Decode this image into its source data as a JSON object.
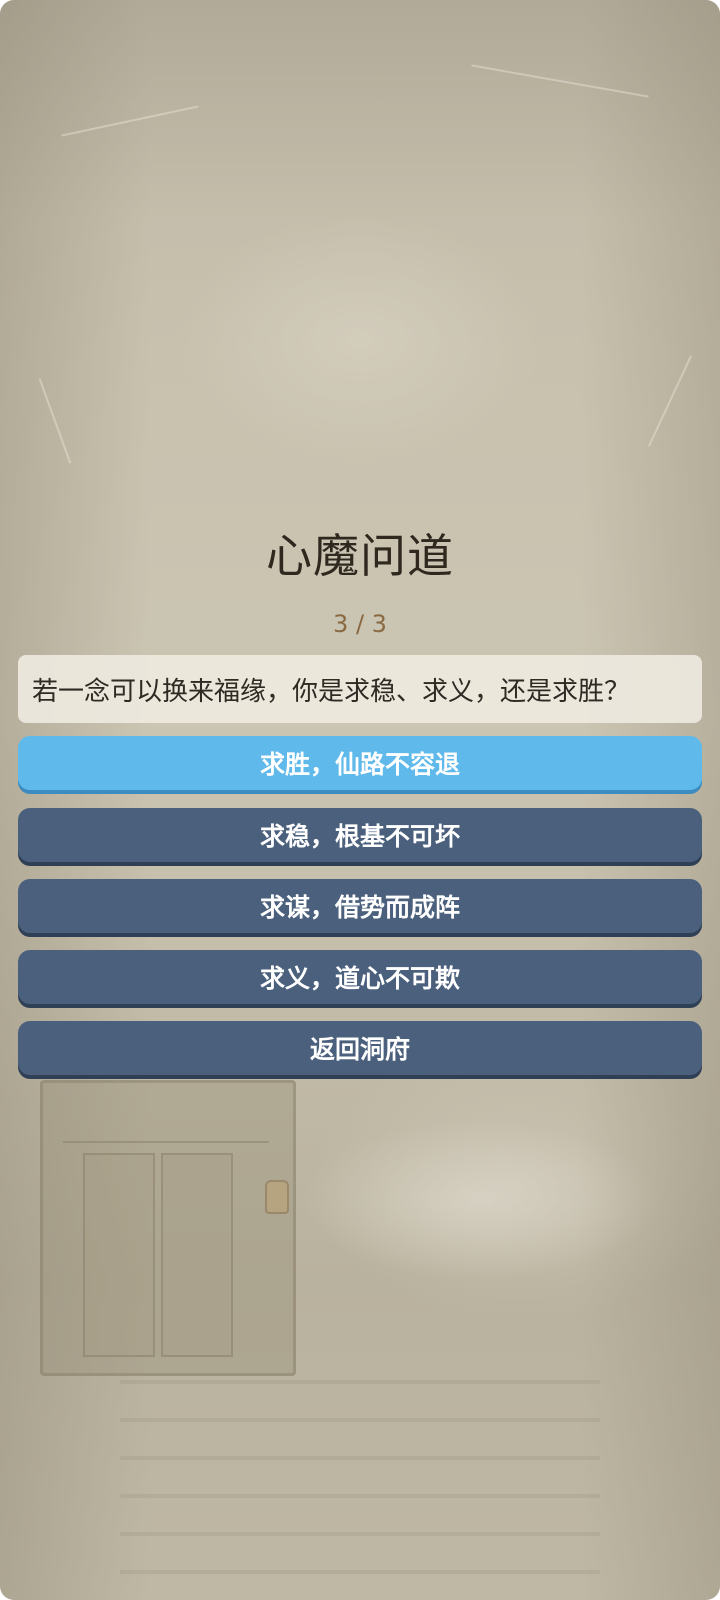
{
  "screen": {
    "title": "心魔问道",
    "progress": "3 / 3",
    "question": "若一念可以换来福缘，你是求稳、求义，还是求胜？"
  },
  "options": [
    {
      "label": "求胜，仙路不容退",
      "selected": true
    },
    {
      "label": "求稳，根基不可坏",
      "selected": false
    },
    {
      "label": "求谋，借势而成阵",
      "selected": false
    },
    {
      "label": "求义，道心不可欺",
      "selected": false
    }
  ],
  "back_button": {
    "label": "返回洞府"
  },
  "colors": {
    "option_default": "#4a607c",
    "option_selected": "#5fb9ea",
    "title": "#2f281f",
    "progress": "#8a6a42"
  }
}
